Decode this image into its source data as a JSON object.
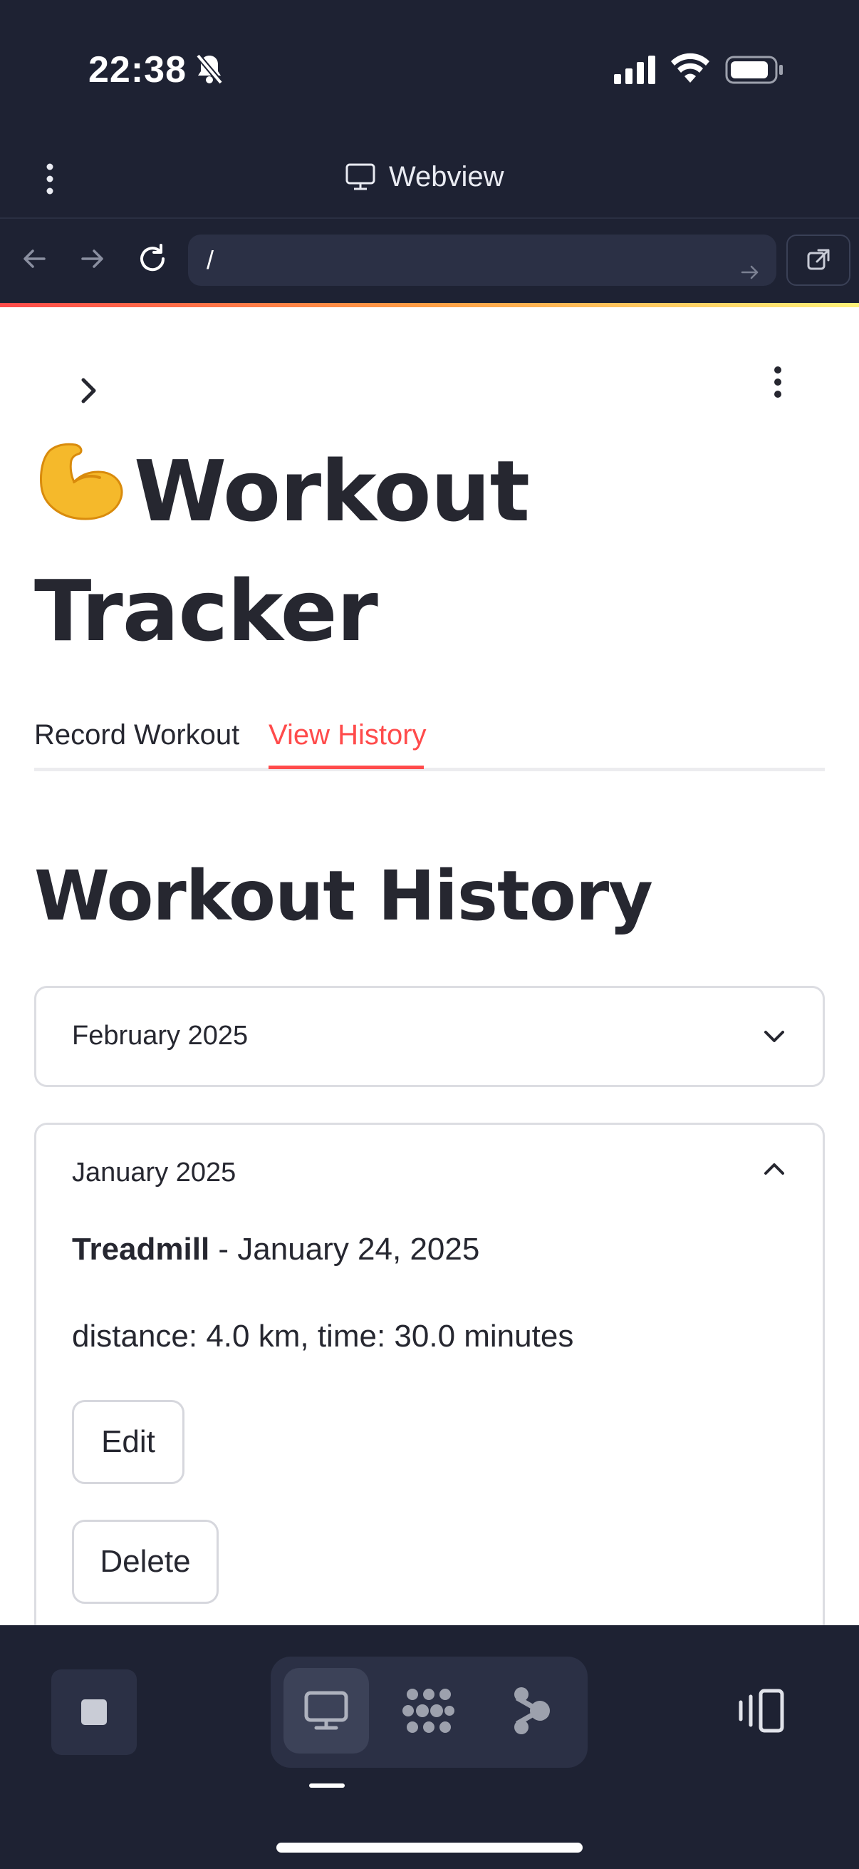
{
  "status": {
    "time": "22:38"
  },
  "webview": {
    "title": "Webview",
    "url": "/"
  },
  "app": {
    "title_emoji": "💪",
    "title": "Workout Tracker",
    "tabs": [
      {
        "label": "Record Workout",
        "active": false
      },
      {
        "label": "View History",
        "active": true
      }
    ],
    "section_title": "Workout History",
    "months": [
      {
        "label": "February 2025",
        "expanded": false
      },
      {
        "label": "January 2025",
        "expanded": true,
        "entry": {
          "exercise": "Treadmill",
          "date_text": " - January 24, 2025",
          "details": "distance: 4.0 km, time: 30.0 minutes",
          "edit_label": "Edit",
          "delete_label": "Delete"
        }
      }
    ]
  },
  "colors": {
    "accent": "#ff4b4b",
    "chrome_bg": "#1e2233",
    "text": "#262730"
  },
  "icons": [
    "bell-slash-icon",
    "signal-icon",
    "wifi-icon",
    "battery-icon",
    "kebab-icon",
    "monitor-icon",
    "back-arrow-icon",
    "forward-arrow-icon",
    "reload-icon",
    "go-arrow-icon",
    "external-link-icon",
    "chevron-right-icon",
    "chevron-down-icon",
    "chevron-up-icon",
    "stop-icon",
    "monitor-icon",
    "grid-dots-icon",
    "graph-node-icon",
    "mirror-device-icon"
  ]
}
